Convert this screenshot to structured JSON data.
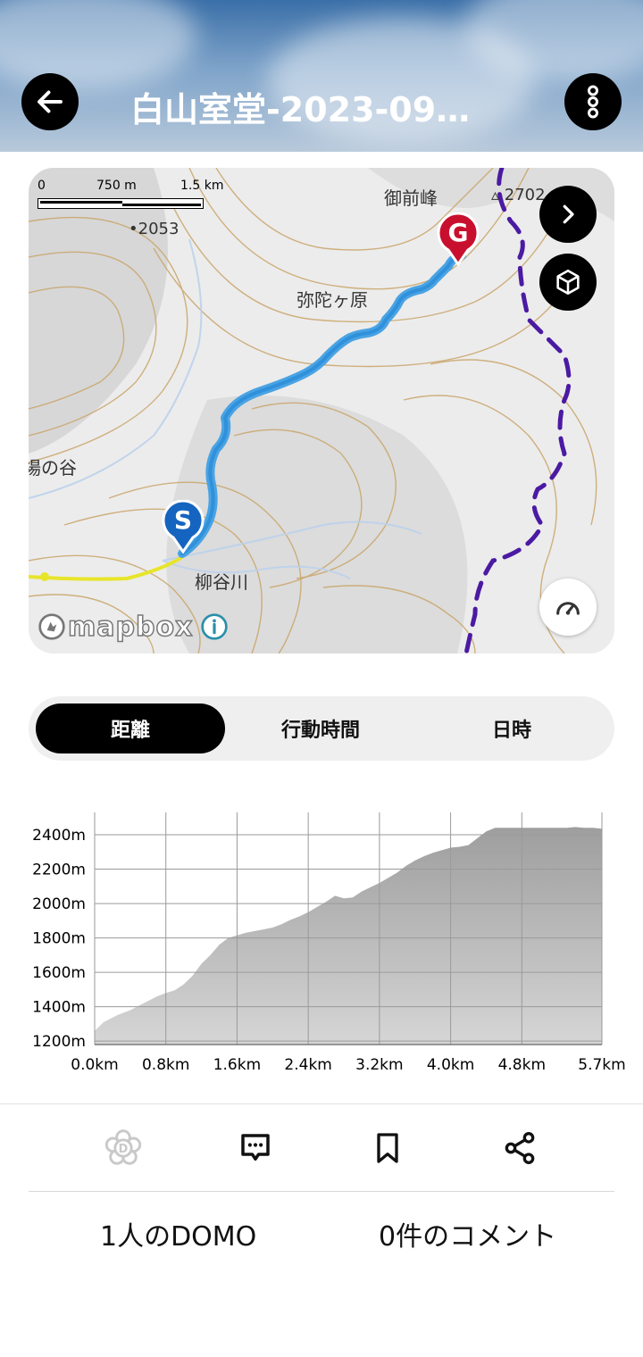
{
  "header": {
    "title": "白山室堂-2023-09…"
  },
  "map": {
    "scale": {
      "zero": "0",
      "mid": "750 m",
      "max": "1.5 km"
    },
    "labels": [
      {
        "text": "御前峰"
      },
      {
        "text": "2702"
      },
      {
        "text": "2053"
      },
      {
        "text": "弥陀ヶ原"
      },
      {
        "text": "柳谷川"
      },
      {
        "text": "場の谷"
      }
    ],
    "start_marker": "S",
    "goal_marker": "G",
    "attribution": "mapbox"
  },
  "tabs": [
    {
      "label": "距離",
      "active": true
    },
    {
      "label": "行動時間",
      "active": false
    },
    {
      "label": "日時",
      "active": false
    }
  ],
  "chart_data": {
    "type": "area",
    "xlabel": "",
    "ylabel": "",
    "x_ticks": [
      "0.0km",
      "0.8km",
      "1.6km",
      "2.4km",
      "3.2km",
      "4.0km",
      "4.8km",
      "5.7km"
    ],
    "y_ticks": [
      "2400m",
      "2200m",
      "2000m",
      "1800m",
      "1600m",
      "1400m",
      "1200m"
    ],
    "xlim": [
      0,
      5.7
    ],
    "ylim": [
      1180,
      2530
    ],
    "x": [
      0,
      0.1,
      0.25,
      0.4,
      0.55,
      0.7,
      0.8,
      0.9,
      1.0,
      1.1,
      1.2,
      1.3,
      1.4,
      1.5,
      1.6,
      1.7,
      1.8,
      1.9,
      2.0,
      2.1,
      2.2,
      2.3,
      2.4,
      2.5,
      2.6,
      2.7,
      2.8,
      2.9,
      3.0,
      3.1,
      3.2,
      3.3,
      3.4,
      3.5,
      3.6,
      3.7,
      3.8,
      3.9,
      4.0,
      4.1,
      4.2,
      4.3,
      4.4,
      4.5,
      4.6,
      4.7,
      4.8,
      4.9,
      5.0,
      5.1,
      5.2,
      5.3,
      5.4,
      5.5,
      5.6,
      5.7
    ],
    "series": [
      {
        "values": [
          1260,
          1310,
          1350,
          1380,
          1420,
          1460,
          1480,
          1495,
          1530,
          1580,
          1650,
          1700,
          1760,
          1800,
          1815,
          1830,
          1840,
          1850,
          1860,
          1880,
          1905,
          1925,
          1950,
          1980,
          2010,
          2045,
          2030,
          2035,
          2070,
          2095,
          2120,
          2150,
          2180,
          2220,
          2250,
          2275,
          2295,
          2310,
          2325,
          2330,
          2340,
          2380,
          2420,
          2440,
          2440,
          2440,
          2440,
          2440,
          2440,
          2440,
          2440,
          2440,
          2445,
          2440,
          2440,
          2435
        ]
      }
    ]
  },
  "actions": {
    "domo_icon": "domo-flower-icon",
    "comment_icon": "comment-icon",
    "bookmark_icon": "bookmark-icon",
    "share_icon": "share-icon"
  },
  "stats": {
    "domo": "1人のDOMO",
    "comments": "0件のコメント"
  }
}
